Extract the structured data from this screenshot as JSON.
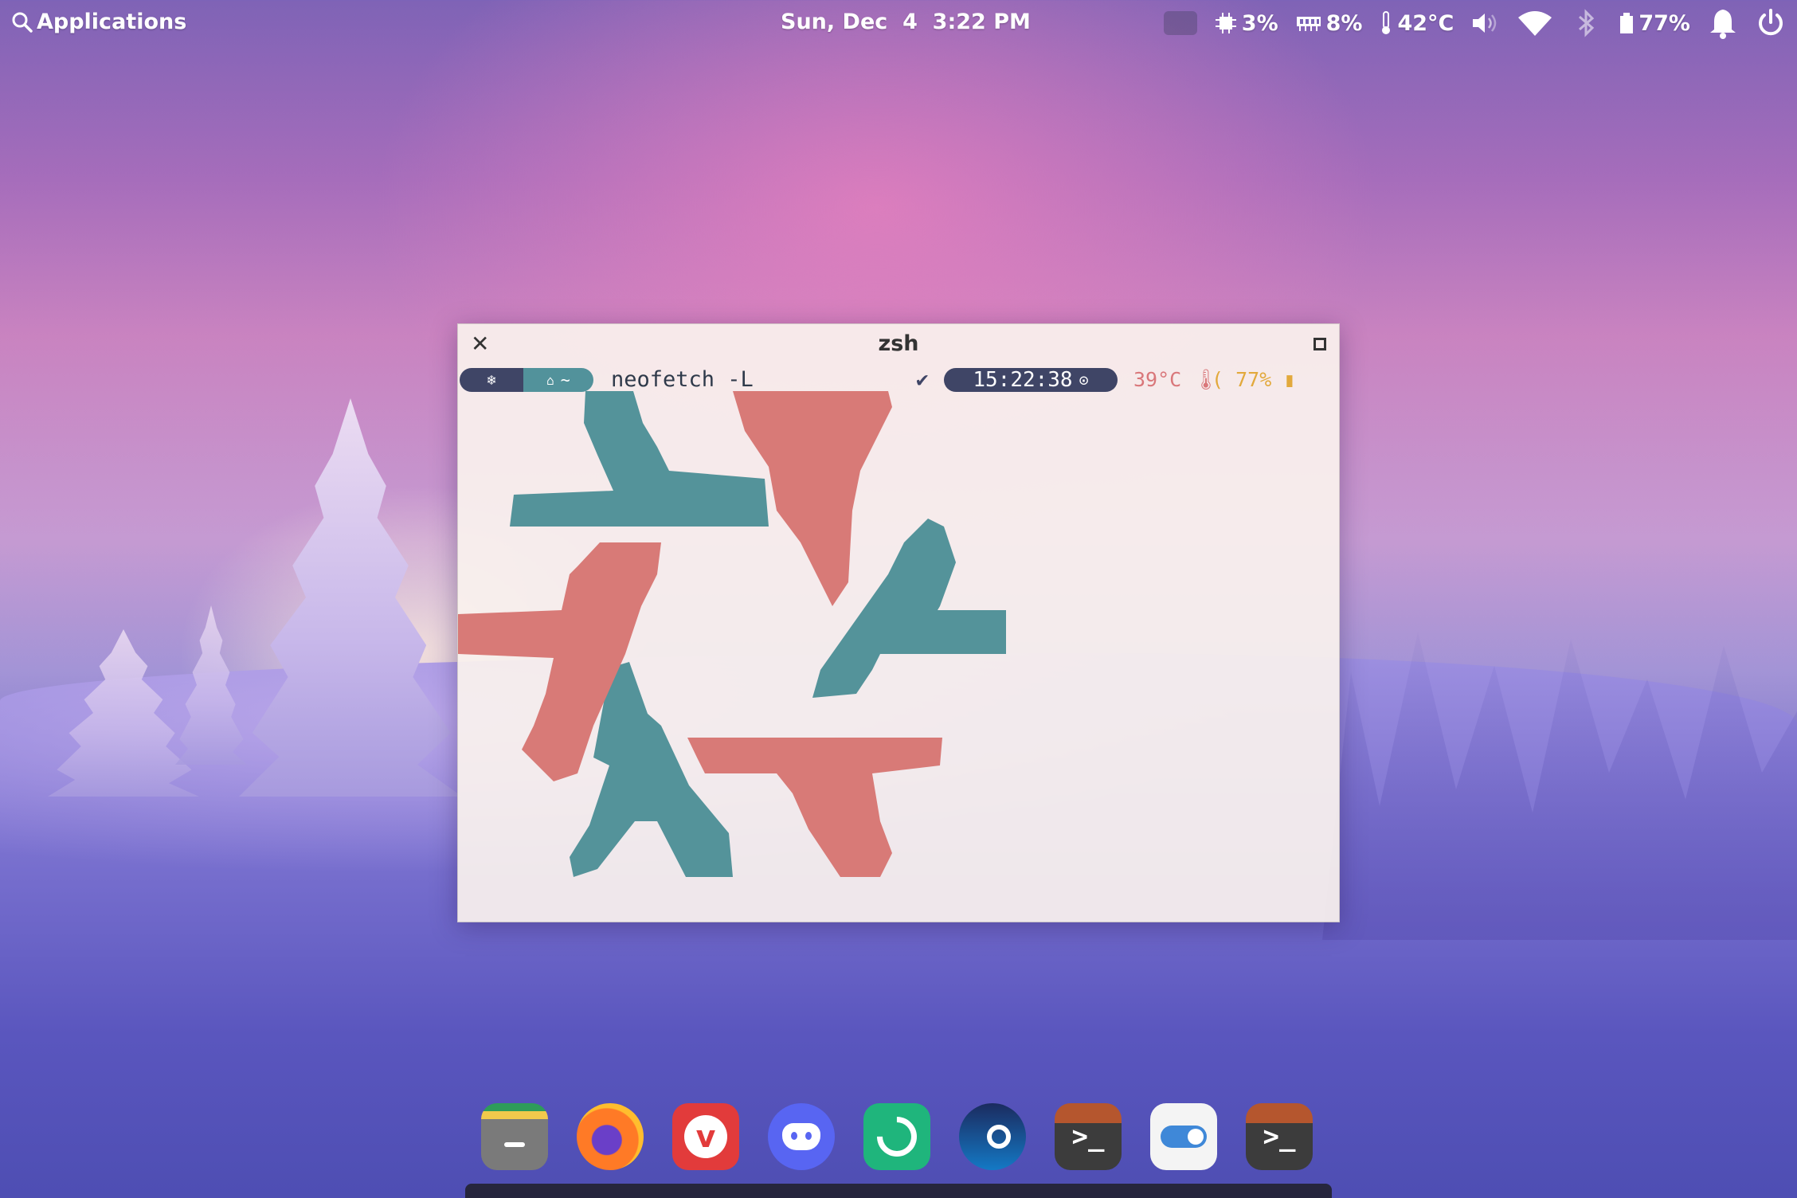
{
  "topbar": {
    "apps_label": "Applications",
    "datetime": "Sun, Dec  4  3:22 PM",
    "cpu": "3%",
    "memory": "8%",
    "temperature": "42°C",
    "battery": "77%",
    "icons": [
      "search-icon",
      "keyboard-icon",
      "cpu-icon",
      "memory-icon",
      "thermometer-icon",
      "volume-icon",
      "wifi-icon",
      "bluetooth-icon",
      "battery-icon",
      "bell-icon",
      "power-icon"
    ]
  },
  "terminal": {
    "title": "zsh",
    "prompt_dir": "~",
    "command": "neofetch -L",
    "status_check": "✔",
    "time": "15:22:38",
    "temp": "39°C",
    "battery": "77%",
    "logo_colors": {
      "teal": "#54939a",
      "pink": "#d87a77"
    }
  },
  "dock": {
    "apps": [
      "files",
      "firefox",
      "vivaldi",
      "discord",
      "chat-app",
      "steam",
      "terminal",
      "toggle-settings",
      "terminal"
    ]
  },
  "colors": {
    "accent_dark": "#3f4566",
    "accent_teal": "#52929b"
  }
}
